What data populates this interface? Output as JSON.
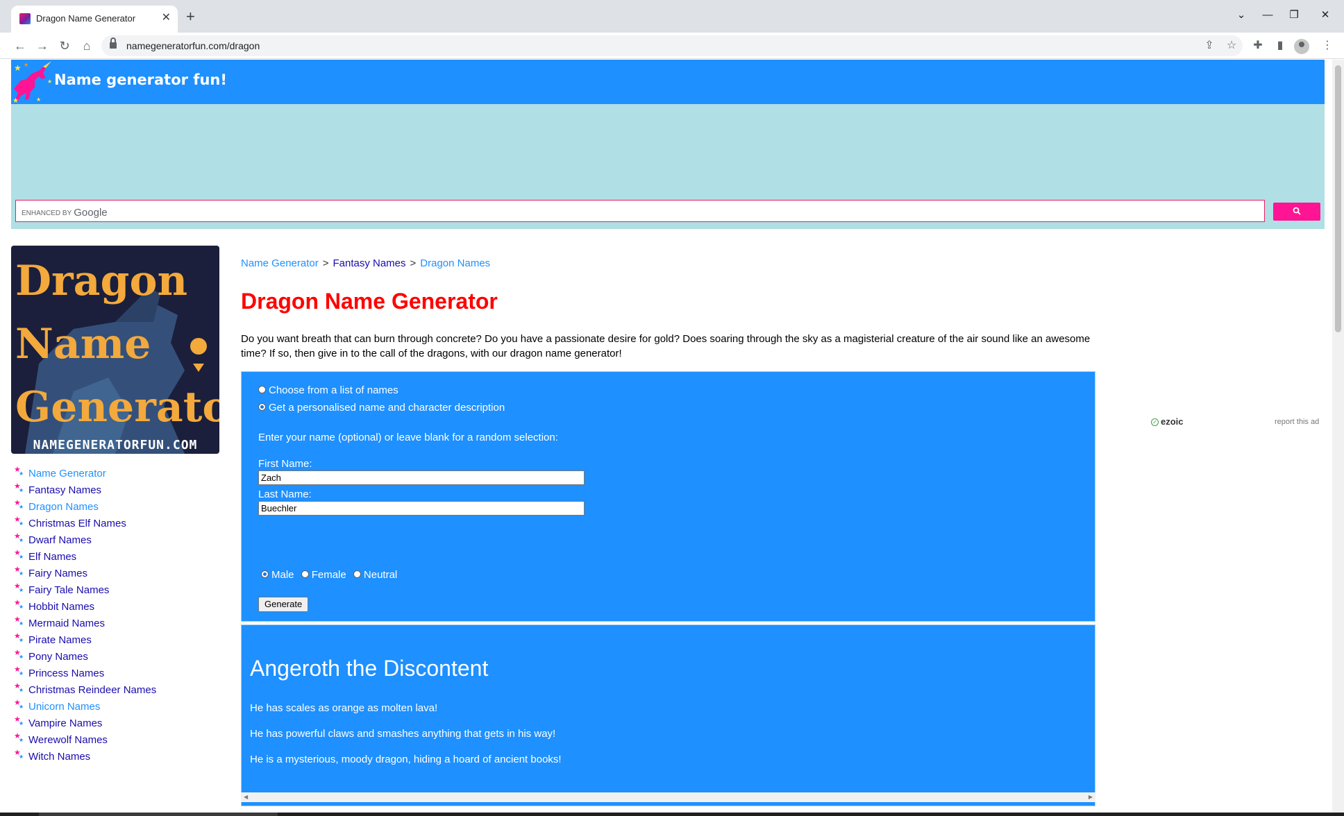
{
  "browser": {
    "tab_title": "Dragon Name Generator",
    "tab_close": "✕",
    "new_tab": "+",
    "url": "namegeneratorfun.com/dragon",
    "window_controls": [
      "⌄",
      "—",
      "❐",
      "✕"
    ]
  },
  "site": {
    "logo_text": "Name generator fun!",
    "search_brand": "ENHANCED BY",
    "search_google": "Google"
  },
  "sidebar": {
    "logo_title": [
      "Dragon",
      "Name",
      "Generator"
    ],
    "logo_url": "NAMEGENERATORFUN.COM",
    "links": [
      {
        "label": "Name Generator",
        "visited": true
      },
      {
        "label": "Fantasy Names",
        "visited": false
      },
      {
        "label": "Dragon Names",
        "visited": true
      },
      {
        "label": "Christmas Elf Names",
        "visited": false
      },
      {
        "label": "Dwarf Names",
        "visited": false
      },
      {
        "label": "Elf Names",
        "visited": false
      },
      {
        "label": "Fairy Names",
        "visited": false
      },
      {
        "label": "Fairy Tale Names",
        "visited": false
      },
      {
        "label": "Hobbit Names",
        "visited": false
      },
      {
        "label": "Mermaid Names",
        "visited": false
      },
      {
        "label": "Pirate Names",
        "visited": false
      },
      {
        "label": "Pony Names",
        "visited": false
      },
      {
        "label": "Princess Names",
        "visited": false
      },
      {
        "label": "Christmas Reindeer Names",
        "visited": false
      },
      {
        "label": "Unicorn Names",
        "visited": true
      },
      {
        "label": "Vampire Names",
        "visited": false
      },
      {
        "label": "Werewolf Names",
        "visited": false
      },
      {
        "label": "Witch Names",
        "visited": false
      }
    ]
  },
  "breadcrumb": {
    "items": [
      "Name Generator",
      "Fantasy Names",
      "Dragon Names"
    ],
    "separator": ">"
  },
  "main": {
    "title": "Dragon Name Generator",
    "intro": "Do you want breath that can burn through concrete? Do you have a passionate desire for gold? Does soaring through the sky as a magisterial creature of the air sound like an awesome time? If so, then give in to the call of the dragons, with our dragon name generator!"
  },
  "form": {
    "option_list": "Choose from a list of names",
    "option_personalised": "Get a personalised name and character description",
    "selected_option": "personalised",
    "prompt": "Enter your name (optional) or leave blank for a random selection:",
    "first_name_label": "First Name:",
    "first_name_value": "Zach",
    "last_name_label": "Last Name:",
    "last_name_value": "Buechler",
    "genders": [
      "Male",
      "Female",
      "Neutral"
    ],
    "selected_gender": "Male",
    "generate_label": "Generate"
  },
  "result": {
    "name": "Angeroth the Discontent",
    "lines": [
      "He has scales as orange as molten lava!",
      "He has powerful claws and smashes anything that gets in his way!",
      "He is a mysterious, moody dragon, hiding a hoard of ancient books!"
    ]
  },
  "ads": {
    "ezoic_label": "ezoic",
    "report_label": "report this ad"
  },
  "colors": {
    "header_blue": "#1e90ff",
    "title_red": "#ff0000",
    "ad_band": "#b0dfe5",
    "search_button": "#ff1493"
  }
}
